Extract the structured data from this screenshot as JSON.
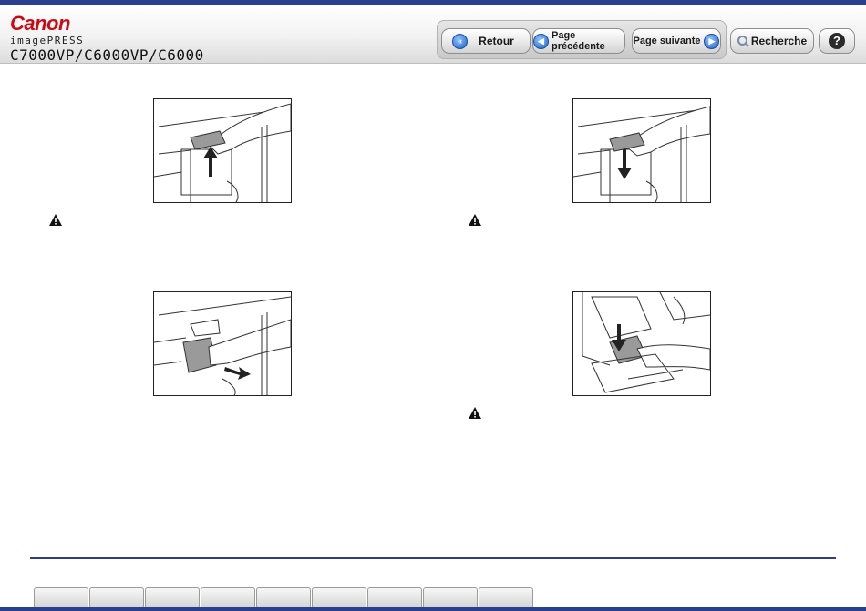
{
  "header": {
    "brand": "Canon",
    "product": "imagePRESS",
    "model": "C7000VP/C6000VP/C6000"
  },
  "nav": {
    "back_label": "Retour",
    "prev_label": "Page précédente",
    "next_label": "Page suivante",
    "search_label": "Recherche",
    "help_label": "?"
  },
  "tabs": [
    {
      "label": ""
    },
    {
      "label": ""
    },
    {
      "label": ""
    },
    {
      "label": ""
    },
    {
      "label": ""
    },
    {
      "label": ""
    },
    {
      "label": ""
    },
    {
      "label": ""
    },
    {
      "label": ""
    }
  ],
  "colors": {
    "accent": "#2b3f8f",
    "brand_red": "#cc0a14",
    "nav_icon_blue": "#1f62c4"
  },
  "icons": {
    "back": "double-chevron-left-icon",
    "prev": "chevron-left-icon",
    "next": "chevron-right-icon",
    "search": "magnifier-icon",
    "help": "question-icon",
    "warning": "warning-triangle-icon"
  }
}
